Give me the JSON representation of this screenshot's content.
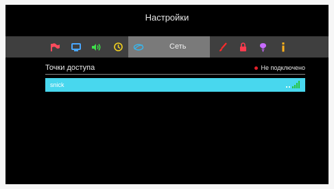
{
  "header": {
    "title": "Настройки"
  },
  "iconbar": {
    "icons": [
      "flag-icon",
      "monitor-icon",
      "volume-icon",
      "clock-icon",
      "network-icon",
      "brush-icon",
      "lock-icon",
      "balloon-icon",
      "info-icon"
    ],
    "active_tab_label": "Сеть"
  },
  "access_points": {
    "title": "Точки доступа",
    "status_text": "Не подключено",
    "status_color": "#e2202a",
    "items": [
      {
        "name": "snick",
        "signal": "full"
      }
    ]
  },
  "colors": {
    "selection": "#48d7ee",
    "iconbar": "#3f3f3f",
    "active_tab": "#7a7a7a",
    "signal": "#27c43a"
  }
}
